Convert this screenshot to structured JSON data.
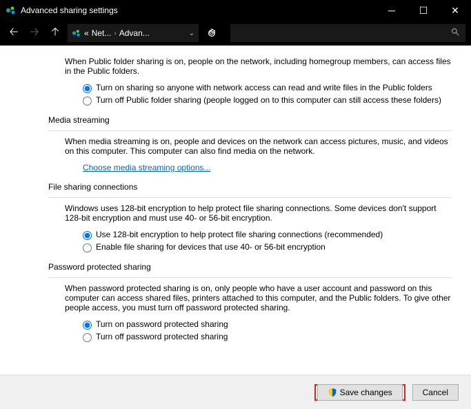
{
  "window": {
    "title": "Advanced sharing settings"
  },
  "breadcrumb": {
    "prefix": "«",
    "item1": "Net...",
    "item2": "Advan..."
  },
  "public_folder": {
    "intro": "When Public folder sharing is on, people on the network, including homegroup members, can access files in the Public folders.",
    "opt_on": "Turn on sharing so anyone with network access can read and write files in the Public folders",
    "opt_off": "Turn off Public folder sharing (people logged on to this computer can still access these folders)"
  },
  "media": {
    "heading": "Media streaming",
    "desc": "When media streaming is on, people and devices on the network can access pictures, music, and videos on this computer. This computer can also find media on the network.",
    "link": "Choose media streaming options..."
  },
  "file_sharing": {
    "heading": "File sharing connections",
    "desc": "Windows uses 128-bit encryption to help protect file sharing connections. Some devices don't support 128-bit encryption and must use 40- or 56-bit encryption.",
    "opt_128": "Use 128-bit encryption to help protect file sharing connections (recommended)",
    "opt_40": "Enable file sharing for devices that use 40- or 56-bit encryption"
  },
  "password": {
    "heading": "Password protected sharing",
    "desc": "When password protected sharing is on, only people who have a user account and password on this computer can access shared files, printers attached to this computer, and the Public folders. To give other people access, you must turn off password protected sharing.",
    "opt_on": "Turn on password protected sharing",
    "opt_off": "Turn off password protected sharing"
  },
  "buttons": {
    "save": "Save changes",
    "cancel": "Cancel"
  }
}
